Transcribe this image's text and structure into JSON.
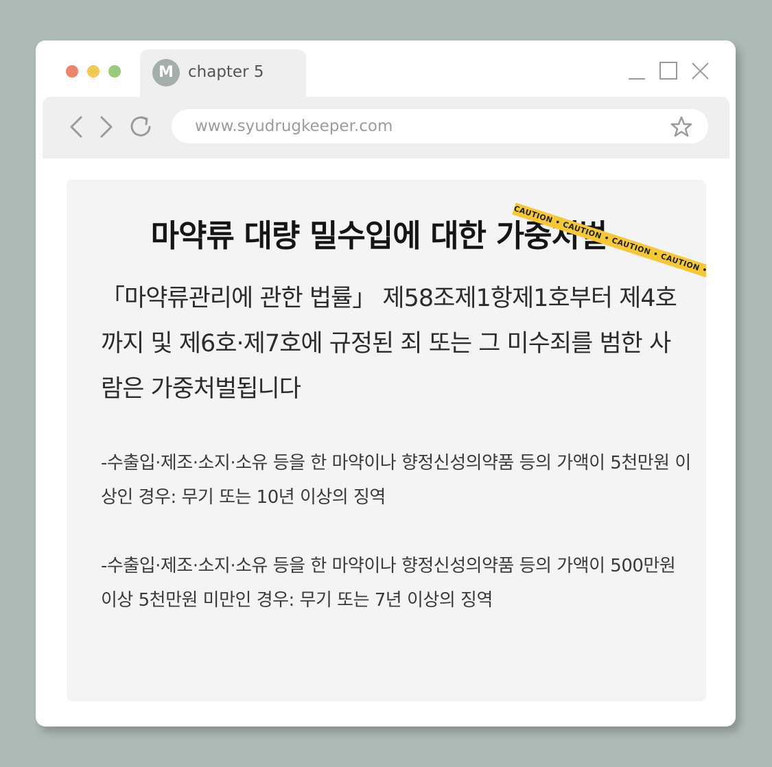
{
  "window": {
    "tab": {
      "avatar_letter": "M",
      "title": "chapter 5"
    },
    "address_bar": {
      "url": "www.syudrugkeeper.com"
    }
  },
  "content": {
    "caution_tape_text": "CAUTION  •  CAUTION  •  CAUTION  •  CAUTION  •",
    "title": "마약류 대량 밀수입에 대한 가중처벌",
    "intro": "「마약류관리에 관한 법률」 제58조제1항제1호부터 제4호까지 및 제6호·제7호에 규정된 죄 또는 그 미수죄를 범한 사람은 가중처벌됩니다",
    "clauses": [
      "-수출입·제조·소지·소유 등을 한 마약이나 향정신성의약품 등의 가액이 5천만원 이상인 경우: 무기 또는 10년 이상의 징역",
      "-수출입·제조·소지·소유 등을 한 마약이나 향정신성의약품 등의 가액이 500만원 이상 5천만원 미만인 경우: 무기 또는 7년 이상의 징역"
    ]
  },
  "colors": {
    "traffic_red": "#ee8366",
    "traffic_yellow": "#f2c94c",
    "traffic_green": "#97cd76",
    "tape": "#f5c835"
  }
}
